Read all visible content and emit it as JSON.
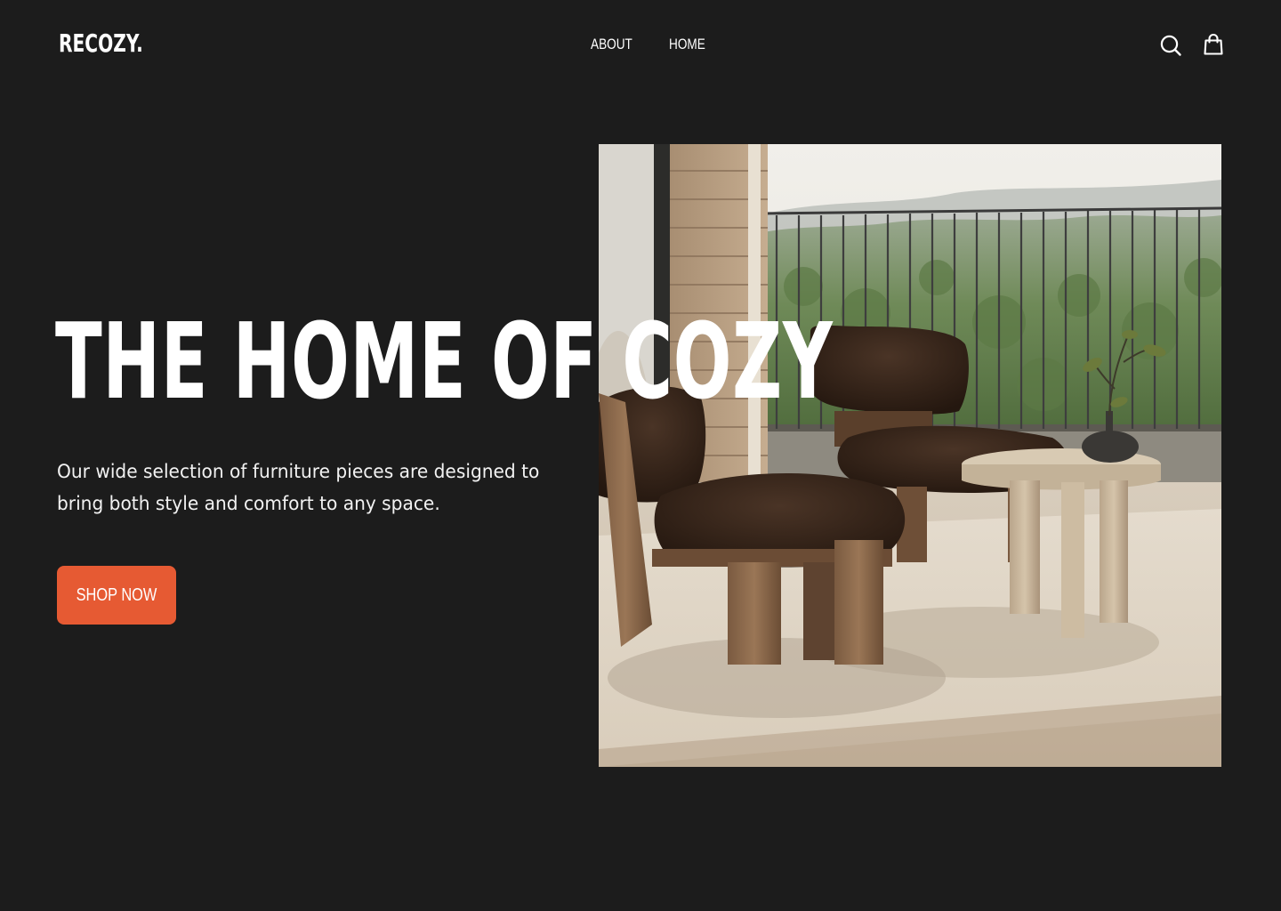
{
  "header": {
    "logo": "RECOZY.",
    "nav": [
      {
        "label": "ABOUT"
      },
      {
        "label": "HOME"
      }
    ],
    "icons": {
      "search": "search-icon",
      "cart": "shopping-bag-icon"
    }
  },
  "hero": {
    "title": "THE HOME OF COZY",
    "description": "Our wide selection of furniture pieces are designed to bring both style and comfort to any space.",
    "cta_label": "SHOP NOW",
    "image_subject": "lounge chairs and side table by balcony"
  },
  "colors": {
    "background": "#1c1c1c",
    "text": "#ffffff",
    "accent": "#e65a33"
  }
}
